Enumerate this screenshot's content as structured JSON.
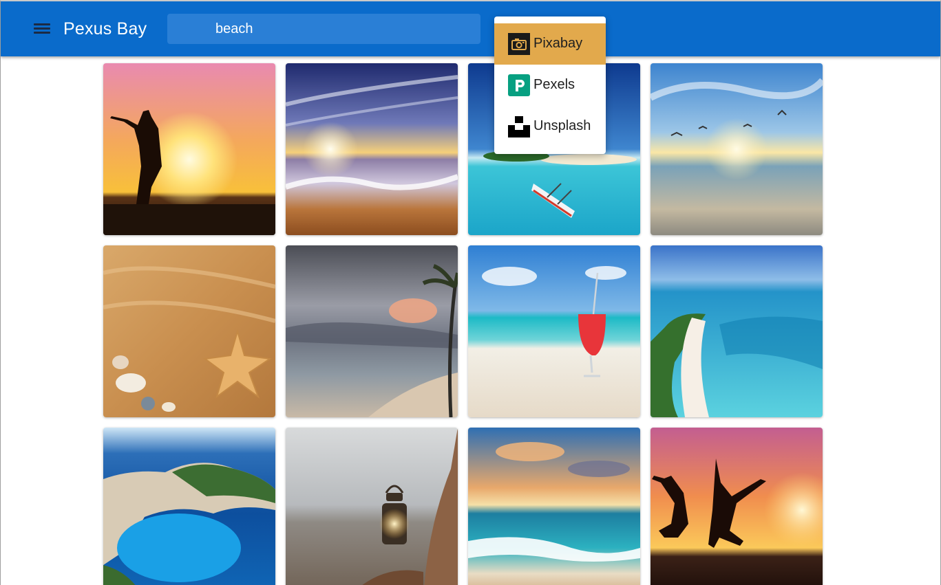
{
  "app": {
    "title": "Pexus Bay",
    "brand_color": "#0a6bcb",
    "menu_icon": "hamburger-menu-icon"
  },
  "search": {
    "value": "beach",
    "placeholder": ""
  },
  "source_menu": {
    "selected": "Pixabay",
    "highlight_color": "#e2a94c",
    "items": [
      {
        "label": "Pixabay",
        "icon": "pixabay-camera-icon"
      },
      {
        "label": "Pexels",
        "icon": "pexels-logo-icon"
      },
      {
        "label": "Unsplash",
        "icon": "unsplash-logo-icon"
      }
    ]
  },
  "results": [
    {
      "subject": "woman-silhouette-sunset"
    },
    {
      "subject": "sunset-wave-on-shore"
    },
    {
      "subject": "tropical-island-outrigger-canoe"
    },
    {
      "subject": "sunrise-sea-with-seagulls"
    },
    {
      "subject": "sand-with-seashells-and-starfish"
    },
    {
      "subject": "stormy-sky-beach-palm"
    },
    {
      "subject": "red-cocktail-on-beach"
    },
    {
      "subject": "aerial-turquoise-lagoon"
    },
    {
      "subject": "navagio-cliffs-shipwreck-bay"
    },
    {
      "subject": "lantern-on-rocky-shore"
    },
    {
      "subject": "colorful-sunset-waves"
    },
    {
      "subject": "two-people-jumping-at-sunset"
    }
  ]
}
